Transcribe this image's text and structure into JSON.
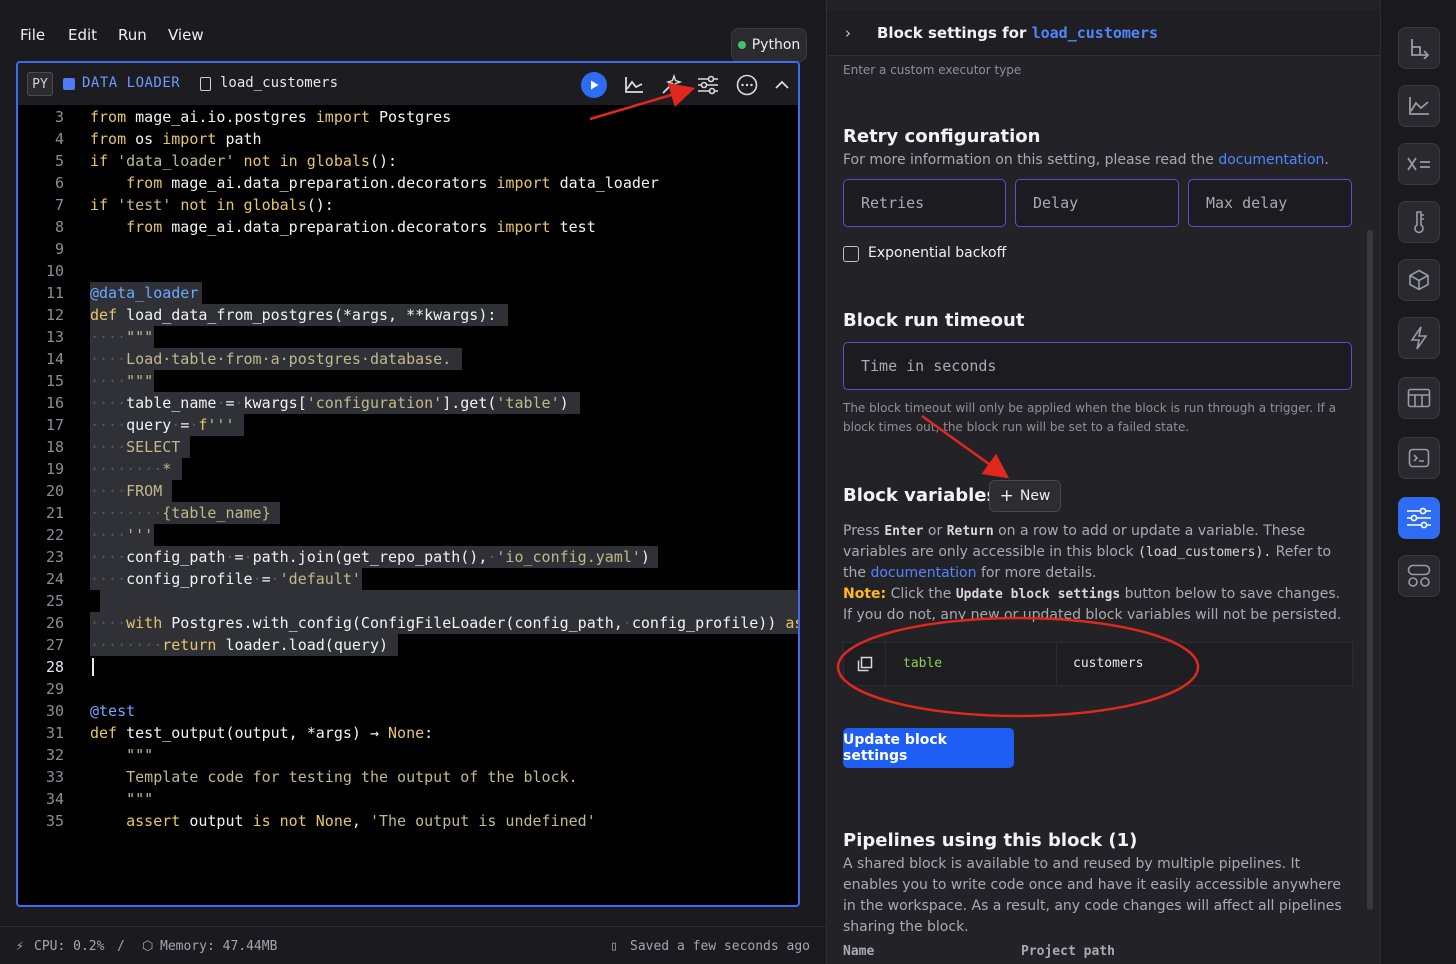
{
  "menu": [
    "File",
    "Edit",
    "Run",
    "View"
  ],
  "kernel_badge": "Python",
  "block": {
    "lang_chip": "PY",
    "type_label": "DATA LOADER",
    "name": "load_customers"
  },
  "code_lines": [
    {
      "n": 3,
      "html": "<span class='kw'>from</span> mage_ai.io.postgres <span class='kw'>import</span> Postgres"
    },
    {
      "n": 4,
      "html": "<span class='kw'>from</span> os <span class='kw'>import</span> path"
    },
    {
      "n": 5,
      "html": "<span class='kw'>if</span> <span class='str'>'data_loader'</span> <span class='kw'>not in</span> <span class='kw'>globals</span>():"
    },
    {
      "n": 6,
      "html": "    <span class='kw'>from</span> mage_ai.data_preparation.decorators <span class='kw'>import</span> data_loader"
    },
    {
      "n": 7,
      "html": "<span class='kw'>if</span> <span class='str'>'test'</span> <span class='kw'>not in</span> <span class='kw'>globals</span>():"
    },
    {
      "n": 8,
      "html": "    <span class='kw'>from</span> mage_ai.data_preparation.decorators <span class='kw'>import</span> test"
    },
    {
      "n": 9,
      "html": ""
    },
    {
      "n": 10,
      "html": ""
    },
    {
      "n": 11,
      "sel": 112,
      "html": "<span class='deco'>@data_loader</span>"
    },
    {
      "n": 12,
      "sel": 418,
      "html": "<span class='kw'>def</span> load_data_from_postgres(*args, **kwargs):"
    },
    {
      "n": 13,
      "sel": 64,
      "html": "<span class='dim'>····</span><span class='cmt'>\"\"\"</span>"
    },
    {
      "n": 14,
      "sel": 372,
      "html": "<span class='dim'>····</span><span class='cmt'>Load·table·from·a·postgres·database.</span>"
    },
    {
      "n": 15,
      "sel": 64,
      "html": "<span class='dim'>····</span><span class='cmt'>\"\"\"</span>"
    },
    {
      "n": 16,
      "sel": 490,
      "html": "<span class='dim'>····</span>table_name<span class='dim'>·</span>=<span class='dim'>·</span>kwargs[<span class='str'>'configuration'</span>].get(<span class='str'>'table'</span>)"
    },
    {
      "n": 17,
      "sel": 154,
      "html": "<span class='dim'>····</span>query<span class='dim'>·</span>=<span class='dim'>·</span><span class='kw'>f</span><span class='str'>'''</span>"
    },
    {
      "n": 18,
      "sel": 100,
      "html": "<span class='dim'>····</span><span class='str'>SELECT</span>"
    },
    {
      "n": 19,
      "sel": 92,
      "html": "<span class='dim'>········</span><span class='str'>*</span>"
    },
    {
      "n": 20,
      "sel": 82,
      "html": "<span class='dim'>····</span><span class='str'>FROM</span>"
    },
    {
      "n": 21,
      "sel": 190,
      "html": "<span class='dim'>········</span><span class='str'>{table_name}</span>"
    },
    {
      "n": 22,
      "sel": 64,
      "html": "<span class='dim'>····</span><span class='str'>'''</span>"
    },
    {
      "n": 23,
      "sel": 568,
      "html": "<span class='dim'>····</span>config_path<span class='dim'>·</span>=<span class='dim'>·</span>path.join(get_repo_path(),<span class='dim'>·</span><span class='str'>'io_config.yaml'</span>)"
    },
    {
      "n": 24,
      "sel": 272,
      "html": "<span class='dim'>····</span>config_profile<span class='dim'>·</span>=<span class='dim'>·</span><span class='str'>'default'</span>"
    },
    {
      "n": 25,
      "sel": 700,
      "html": ""
    },
    {
      "n": 26,
      "sel": 710,
      "html": "<span class='dim'>····</span><span class='kw'>with</span> Postgres.with_config(ConfigFileLoader(config_path,<span class='dim'>·</span>config_profile)) <span class='kw'>as</span> loader:"
    },
    {
      "n": 27,
      "sel": 308,
      "html": "<span class='dim'>········</span><span class='kw'>return</span> loader.load(query)"
    },
    {
      "n": 28,
      "cur": true,
      "html": ""
    },
    {
      "n": 29,
      "html": ""
    },
    {
      "n": 30,
      "html": "<span class='deco'>@test</span>"
    },
    {
      "n": 31,
      "html": "<span class='kw'>def</span> test_output(output, *args) → <span class='kw'>None</span>:"
    },
    {
      "n": 32,
      "html": "    <span class='cmt'>\"\"\"</span>"
    },
    {
      "n": 33,
      "html": "    <span class='cmt'>Template code for testing the output of the block.</span>"
    },
    {
      "n": 34,
      "html": "    <span class='cmt'>\"\"\"</span>"
    },
    {
      "n": 35,
      "html": "    <span class='kw'>assert</span> output <span class='kw'>is not</span> <span class='kw'>None</span>, <span class='str'>'The output is undefined'</span>"
    }
  ],
  "status": {
    "cpu": "CPU: 0.2%",
    "sep": "/",
    "memory": "Memory: 47.44MB",
    "saved": "Saved a few seconds ago"
  },
  "panel": {
    "title_prefix": "Block settings for",
    "title_block": "load_customers",
    "executor_hint": "Enter a custom executor type",
    "retry_title": "Retry configuration",
    "retry_desc": "For more information on this setting, please read the",
    "retry_link": "documentation",
    "retries_placeholder": "Retries",
    "delay_placeholder": "Delay",
    "max_delay_placeholder": "Max delay",
    "exp_backoff": "Exponential backoff",
    "timeout_title": "Block run timeout",
    "timeout_placeholder": "Time in seconds",
    "timeout_desc": "The block timeout will only be applied when the block is run through a trigger. If a block times out, the block run will be set to a failed state.",
    "vars_title": "Block variables",
    "new_label": "New",
    "vars_press": "Press",
    "vars_enter": "Enter",
    "vars_or": "or",
    "vars_return": "Return",
    "vars_desc1": "on a row to add or update a variable. These variables are only accessible in this block",
    "vars_code": "(load_customers).",
    "vars_refer": "Refer to the",
    "vars_link": "documentation",
    "vars_more": "for more details.",
    "note_label": "Note:",
    "note_click": "Click the",
    "note_button": "Update block settings",
    "note_rest": "button below to save changes. If you do not, any new or updated block variables will not be persisted.",
    "var_key": "table",
    "var_value": "customers",
    "update_button": "Update block settings",
    "pipelines_title": "Pipelines using this block (1)",
    "pipelines_desc": "A shared block is available to and reused by multiple pipelines. It enables you to write code once and have it easily accessible anywhere in the workspace. As a result, any code changes will affect all pipelines sharing the block.",
    "col_name": "Name",
    "col_path": "Project path"
  },
  "rail_icons": [
    "tree-icon",
    "chart-icon",
    "variables-icon",
    "thermometer-icon",
    "cube-icon",
    "lightning-icon",
    "table-icon",
    "terminal-icon",
    "settings-sliders-icon",
    "blocks-icon"
  ]
}
